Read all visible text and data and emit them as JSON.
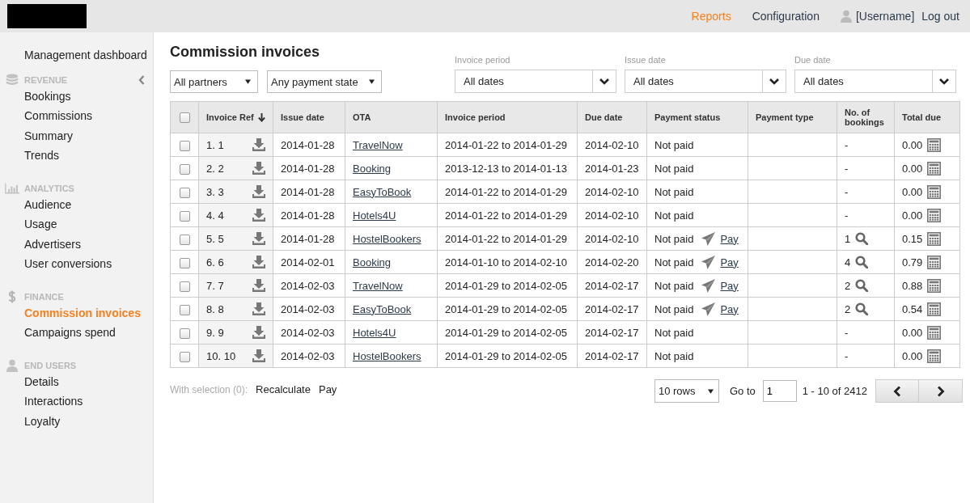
{
  "topbar": {
    "nav": [
      {
        "label": "Reports",
        "selected": true
      },
      {
        "label": "Configuration",
        "selected": false
      }
    ],
    "username": "[Username]",
    "logout": "Log out"
  },
  "sidebar": {
    "top_item": "Management dashboard",
    "sections": [
      {
        "title": "REVENUE",
        "kind": "database",
        "collapsible": true,
        "items": [
          {
            "label": "Bookings",
            "selected": false
          },
          {
            "label": "Commissions",
            "selected": false
          },
          {
            "label": "Summary",
            "selected": false
          },
          {
            "label": "Trends",
            "selected": false
          }
        ]
      },
      {
        "title": "ANALYTICS",
        "kind": "chart",
        "collapsible": false,
        "items": [
          {
            "label": "Audience",
            "selected": false
          },
          {
            "label": "Usage",
            "selected": false
          },
          {
            "label": "Advertisers",
            "selected": false
          },
          {
            "label": "User conversions",
            "selected": false
          }
        ]
      },
      {
        "title": "FINANCE",
        "kind": "dollar",
        "collapsible": false,
        "items": [
          {
            "label": "Commission invoices",
            "selected": true
          },
          {
            "label": "Campaigns spend",
            "selected": false
          }
        ]
      },
      {
        "title": "END USERS",
        "kind": "user",
        "collapsible": false,
        "items": [
          {
            "label": "Details",
            "selected": false
          },
          {
            "label": "Interactions",
            "selected": false
          },
          {
            "label": "Loyalty",
            "selected": false
          }
        ]
      }
    ]
  },
  "page_title": "Commission invoices",
  "filters": {
    "selects": [
      "All partners",
      "Any payment state"
    ],
    "date_filters": [
      {
        "label": "Invoice period",
        "value": "All dates"
      },
      {
        "label": "Issue date",
        "value": "All dates"
      },
      {
        "label": "Due date",
        "value": "All dates"
      }
    ]
  },
  "table": {
    "select_all_checked": false,
    "columns": [
      "Invoice Ref",
      "Issue date",
      "OTA",
      "Invoice period",
      "Due date",
      "Payment status",
      "Payment type",
      "No. of bookings",
      "Total due"
    ],
    "rows": [
      {
        "checked": false,
        "ref": "1. 1",
        "issue": "2014-01-28",
        "ota": "TravelNow",
        "period": "2014-01-22 to 2014-01-29",
        "due": "2014-02-10",
        "status": "Not paid",
        "pay_link": null,
        "bookings": "-",
        "details": false,
        "total": "0.00"
      },
      {
        "checked": false,
        "ref": "2. 2",
        "issue": "2014-01-28",
        "ota": "Booking",
        "period": "2013-12-13 to 2014-01-13",
        "due": "2014-01-23",
        "status": "Not paid",
        "pay_link": null,
        "bookings": "-",
        "details": false,
        "total": "0.00"
      },
      {
        "checked": false,
        "ref": "3. 3",
        "issue": "2014-01-28",
        "ota": "EasyToBook",
        "period": "2014-01-22 to 2014-01-29",
        "due": "2014-02-10",
        "status": "Not paid",
        "pay_link": null,
        "bookings": "-",
        "details": false,
        "total": "0.00"
      },
      {
        "checked": false,
        "ref": "4. 4",
        "issue": "2014-01-28",
        "ota": "Hotels4U",
        "period": "2014-01-22 to 2014-01-29",
        "due": "2014-02-10",
        "status": "Not paid",
        "pay_link": null,
        "bookings": "-",
        "details": false,
        "total": "0.00"
      },
      {
        "checked": false,
        "ref": "5. 5",
        "issue": "2014-01-28",
        "ota": "HostelBookers",
        "period": "2014-01-22 to 2014-01-29",
        "due": "2014-02-10",
        "status": "Not paid",
        "pay_link": "Pay",
        "bookings": "1",
        "details": true,
        "total": "0.15"
      },
      {
        "checked": false,
        "ref": "6. 6",
        "issue": "2014-02-01",
        "ota": "Booking",
        "period": "2014-01-10 to 2014-02-10",
        "due": "2014-02-20",
        "status": "Not paid",
        "pay_link": "Pay",
        "bookings": "4",
        "details": true,
        "total": "0.79"
      },
      {
        "checked": false,
        "ref": "7. 7",
        "issue": "2014-02-03",
        "ota": "TravelNow",
        "period": "2014-01-29 to 2014-02-05",
        "due": "2014-02-17",
        "status": "Not paid",
        "pay_link": "Pay",
        "bookings": "2",
        "details": true,
        "total": "0.88"
      },
      {
        "checked": false,
        "ref": "8. 8",
        "issue": "2014-02-03",
        "ota": "EasyToBook",
        "period": "2014-01-29 to 2014-02-05",
        "due": "2014-02-17",
        "status": "Not paid",
        "pay_link": "Pay",
        "bookings": "2",
        "details": true,
        "total": "0.54"
      },
      {
        "checked": false,
        "ref": "9. 9",
        "issue": "2014-02-03",
        "ota": "Hotels4U",
        "period": "2014-01-29 to 2014-02-05",
        "due": "2014-02-17",
        "status": "Not paid",
        "pay_link": null,
        "bookings": "-",
        "details": false,
        "total": "0.00"
      },
      {
        "checked": false,
        "ref": "10. 10",
        "issue": "2014-02-03",
        "ota": "HostelBookers",
        "period": "2014-01-29 to 2014-02-05",
        "due": "2014-02-17",
        "status": "Not paid",
        "pay_link": null,
        "bookings": "-",
        "details": false,
        "total": "0.00"
      }
    ]
  },
  "footer": {
    "selection_label": "With selection (0):",
    "actions": [
      "Recalculate",
      "Pay"
    ],
    "rows_select": "10 rows",
    "goto_label": "Go to",
    "goto_value": "1",
    "range": "1 - 10 of 2412"
  }
}
